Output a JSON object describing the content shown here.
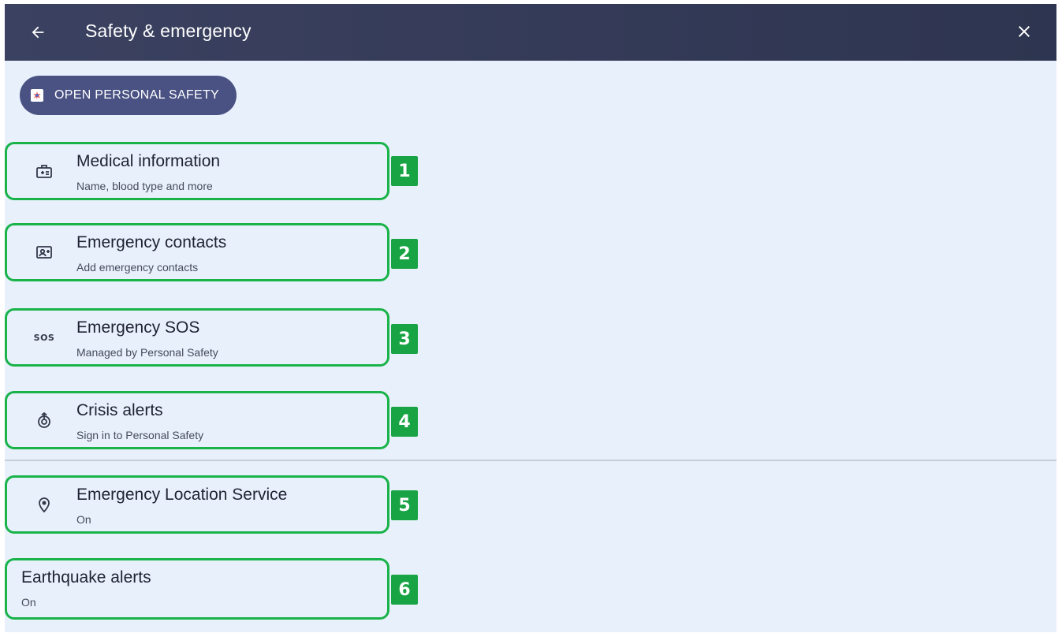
{
  "header": {
    "title": "Safety & emergency",
    "back_icon": "arrow-left-icon",
    "close_icon": "close-icon",
    "background": "#343a58"
  },
  "chip": {
    "label": "OPEN PERSONAL SAFETY",
    "icon": "personal-safety-app-icon",
    "background": "#4a5283"
  },
  "items": [
    {
      "primary": "Medical information",
      "secondary": "Name, blood type and more",
      "icon": "medical-id-icon",
      "badge": "1"
    },
    {
      "primary": "Emergency contacts",
      "secondary": "Add emergency contacts",
      "icon": "contact-card-icon",
      "badge": "2"
    },
    {
      "primary": "Emergency SOS",
      "secondary": "Managed by Personal Safety",
      "icon": "sos-icon",
      "icon_text": "SOS",
      "badge": "3"
    },
    {
      "primary": "Crisis alerts",
      "secondary": "Sign in to Personal Safety",
      "icon": "crisis-alert-icon",
      "badge": "4"
    },
    {
      "primary": "Emergency Location Service",
      "secondary": "On",
      "icon": "location-pin-icon",
      "badge": "5"
    },
    {
      "primary": "Earthquake alerts",
      "secondary": "On",
      "icon": "",
      "badge": "6"
    }
  ],
  "colors": {
    "highlight_border": "#19b34a",
    "badge": "#18a444",
    "page_background": "#e8f1fb"
  }
}
